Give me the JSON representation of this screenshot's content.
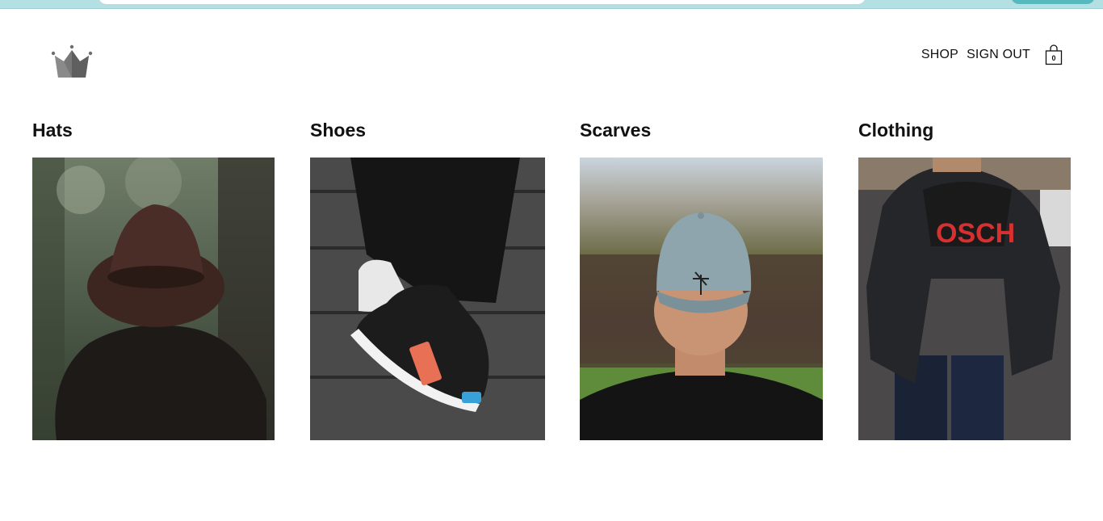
{
  "header": {
    "logo_icon": "crown-icon",
    "nav": {
      "shop": "SHOP",
      "sign_out": "SIGN OUT"
    },
    "cart": {
      "icon": "shopping-bag-icon",
      "count": "0"
    }
  },
  "categories": [
    {
      "title": "Hats"
    },
    {
      "title": "Shoes"
    },
    {
      "title": "Scarves"
    },
    {
      "title": "Clothing"
    }
  ],
  "colors": {
    "browser_bar": "#b5e0e3",
    "browser_accent": "#57b8be",
    "logo_gray": "#6e6e6e"
  }
}
